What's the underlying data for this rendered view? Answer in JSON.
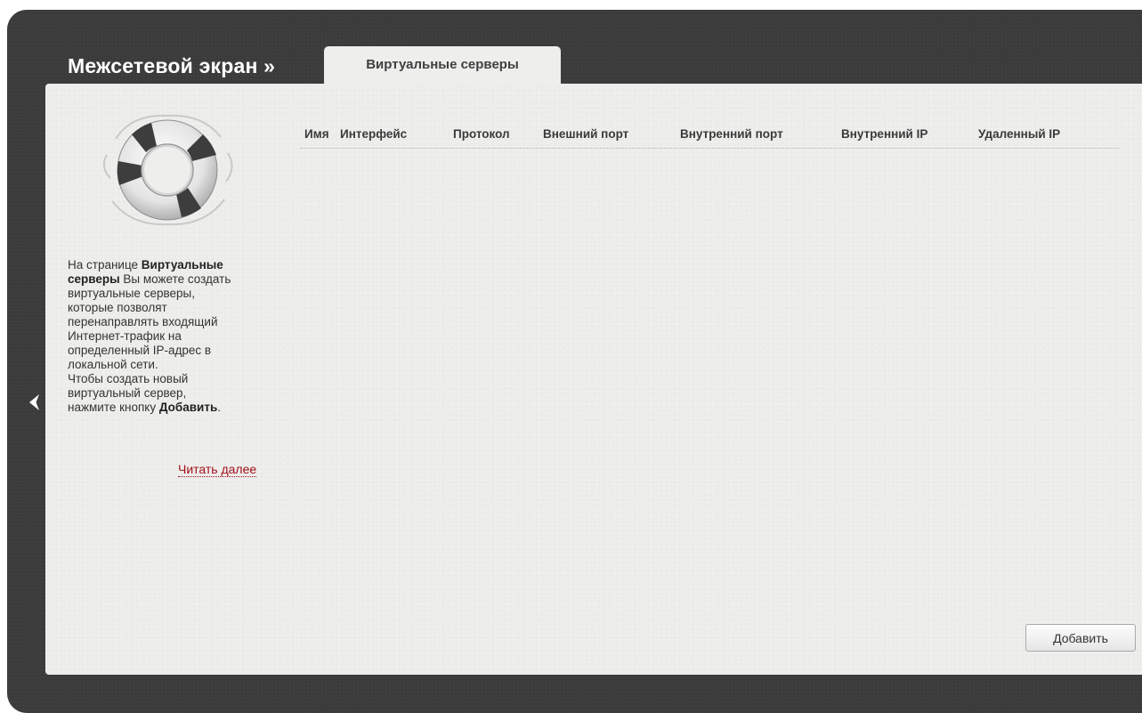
{
  "header": {
    "title": "Межсетевой экран »",
    "active_tab": "Виртуальные серверы"
  },
  "sidebar": {
    "icon": "lifebuoy-icon",
    "help_lines": [
      [
        {
          "t": "На странице ",
          "b": false
        },
        {
          "t": "Виртуальные",
          "b": true
        }
      ],
      [
        {
          "t": "серверы",
          "b": true
        },
        {
          "t": " Вы можете создать",
          "b": false
        }
      ],
      [
        {
          "t": "виртуальные серверы,",
          "b": false
        }
      ],
      [
        {
          "t": "которые позволят",
          "b": false
        }
      ],
      [
        {
          "t": "перенаправлять входящий",
          "b": false
        }
      ],
      [
        {
          "t": "Интернет-трафик на",
          "b": false
        }
      ],
      [
        {
          "t": "определенный IP-адрес в",
          "b": false
        }
      ],
      [
        {
          "t": "локальной сети.",
          "b": false
        }
      ],
      [
        {
          "t": "Чтобы создать новый",
          "b": false
        }
      ],
      [
        {
          "t": "виртуальный сервер,",
          "b": false
        }
      ],
      [
        {
          "t": "нажмите кнопку ",
          "b": false
        },
        {
          "t": "Добавить",
          "b": true
        },
        {
          "t": ".",
          "b": false
        }
      ]
    ],
    "read_more": "Читать далее"
  },
  "table": {
    "columns": [
      "Имя",
      "Интерфейс",
      "Протокол",
      "Внешний порт",
      "Внутренний порт",
      "Внутренний IP",
      "Удаленный IP"
    ],
    "rows": []
  },
  "actions": {
    "add_label": "Добавить"
  },
  "colors": {
    "frame": "#3b3b3b",
    "panel": "#eeeeec",
    "link": "#a0101a"
  }
}
